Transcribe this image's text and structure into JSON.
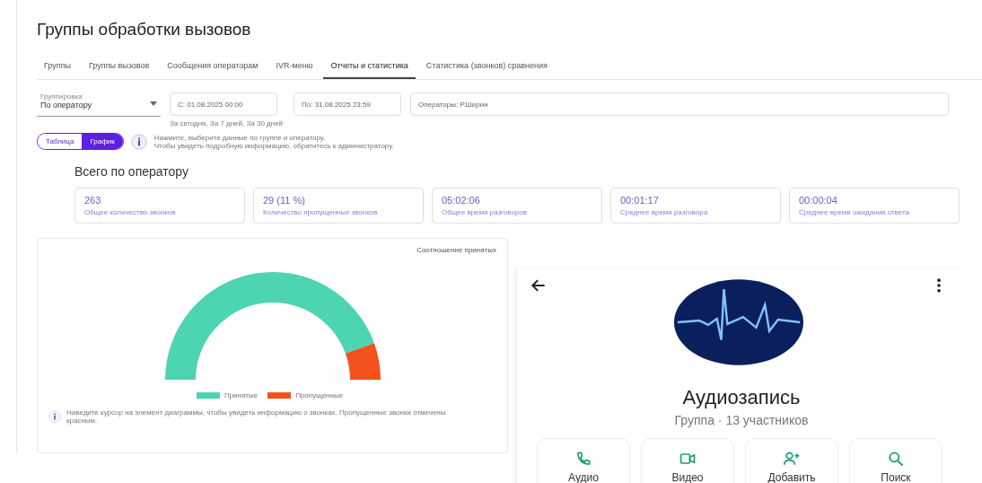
{
  "page_title": "Группы обработки вызовов",
  "tabs": [
    {
      "label": "Группы",
      "selected": false
    },
    {
      "label": "Группы вызовов",
      "selected": false
    },
    {
      "label": "Сообщения операторам",
      "selected": false
    },
    {
      "label": "IVR-меню",
      "selected": false
    },
    {
      "label": "Отчеты и статистика",
      "selected": true
    },
    {
      "label": "Статистика (звонков) сравнения",
      "selected": false
    }
  ],
  "filters": {
    "group_by": {
      "label": "Группировка",
      "value": "По оператору"
    },
    "date_from": "С: 01.08.2025 00:00",
    "date_to": "По: 31.08.2025 23:59",
    "operators": "Операторы: Р.Ширин",
    "quick_ranges": "За сегодня, За 7 дней, За 30 дней"
  },
  "view_toggle": [
    {
      "label": "Таблица",
      "selected": false
    },
    {
      "label": "График",
      "selected": true
    }
  ],
  "info_note": [
    "Нажмите, выберите данные по группе и оператору.",
    "Чтобы увидеть подробную информацию, обратитесь к администратору."
  ],
  "section_title": "Всего по оператору",
  "stats": [
    {
      "value": "263",
      "label": "Общее количество звонков"
    },
    {
      "value": "29 (11 %)",
      "label": "Количество пропущенных звонков"
    },
    {
      "value": "05:02:06",
      "label": "Общее время разговоров"
    },
    {
      "value": "00:01:17",
      "label": "Среднее время разговора"
    },
    {
      "value": "00:00:04",
      "label": "Среднее время ожидания ответа"
    }
  ],
  "chart_card": {
    "title": "Соотношение принятых",
    "legend": [
      {
        "label": "Принятые",
        "color": "#4dd4b0"
      },
      {
        "label": "Пропущенные",
        "color": "#f4511e"
      }
    ],
    "note": "Наведите курсор на элемент диаграммы, чтобы увидеть информацию о звонках. Пропущенные звонки отмечены",
    "note_line2": "красным."
  },
  "overlay": {
    "title": "Аудиозапись",
    "subtitle": "Группа · 13 участников",
    "actions": [
      {
        "kind": "audio",
        "label": "Аудио"
      },
      {
        "kind": "video",
        "label": "Видео"
      },
      {
        "kind": "add",
        "label": "Добавить"
      },
      {
        "kind": "search",
        "label": "Поиск"
      }
    ]
  }
}
